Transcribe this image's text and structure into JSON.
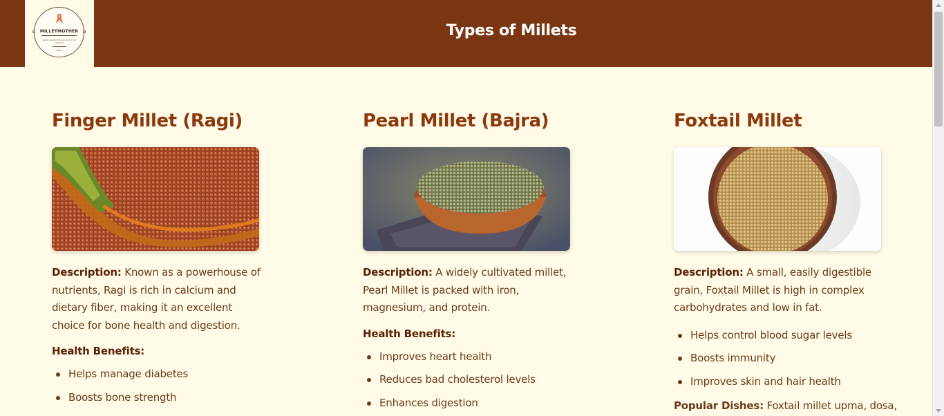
{
  "header": {
    "title": "Types of Millets",
    "logo": {
      "brand": "MILLETMOTHER",
      "tagline": "EVERY GRAIN TELLS A STORY OF HEALTH",
      "est": "2023"
    }
  },
  "colors": {
    "header_bg": "#7a3512",
    "page_bg": "#fffbe6",
    "heading": "#8b3a10",
    "text": "#6a3a1c"
  },
  "cards": [
    {
      "title": "Finger Millet (Ragi)",
      "image_alt": "finger-millet-photo",
      "description_label": "Description:",
      "description": "Known as a powerhouse of nutrients, Ragi is rich in calcium and dietary fiber, making it an excellent choice for bone health and digestion.",
      "benefits_label": "Health Benefits:",
      "benefits": [
        "Helps manage diabetes",
        "Boosts bone strength"
      ]
    },
    {
      "title": "Pearl Millet (Bajra)",
      "image_alt": "pearl-millet-photo",
      "description_label": "Description:",
      "description": "A widely cultivated millet, Pearl Millet is packed with iron, magnesium, and protein.",
      "benefits_label": "Health Benefits:",
      "benefits": [
        "Improves heart health",
        "Reduces bad cholesterol levels",
        "Enhances digestion"
      ]
    },
    {
      "title": "Foxtail Millet",
      "image_alt": "foxtail-millet-photo",
      "description_label": "Description:",
      "description": "A small, easily digestible grain, Foxtail Millet is high in complex carbohydrates and low in fat.",
      "benefits": [
        "Helps control blood sugar levels",
        "Boosts immunity",
        "Improves skin and hair health"
      ],
      "dishes_label": "Popular Dishes:",
      "dishes": "Foxtail millet upma, dosa,"
    }
  ]
}
